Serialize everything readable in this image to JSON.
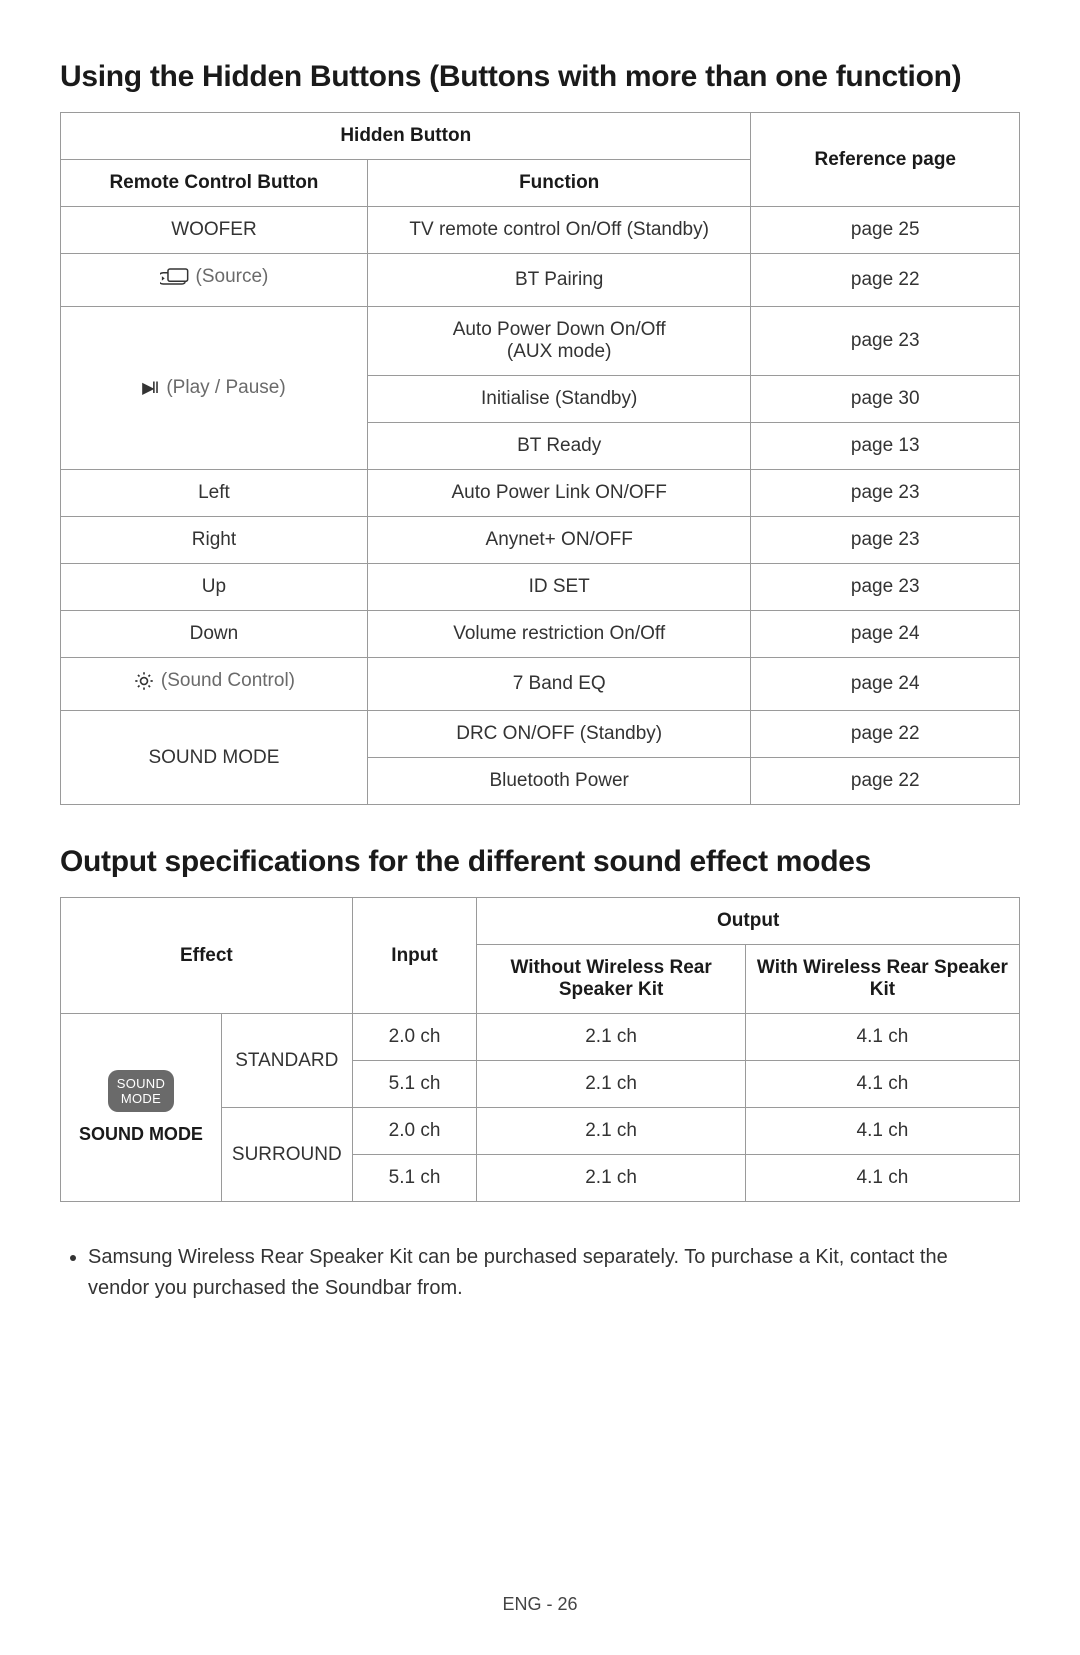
{
  "section1": {
    "title": "Using the Hidden Buttons (Buttons with more than one function)",
    "headers": {
      "hidden_button": "Hidden Button",
      "remote": "Remote Control Button",
      "function": "Function",
      "ref": "Reference page"
    },
    "rows": {
      "woofer": {
        "button": "WOOFER",
        "function": "TV remote control On/Off (Standby)",
        "ref": "page 25"
      },
      "source": {
        "button": "(Source)",
        "function": "BT Pairing",
        "ref": "page 22"
      },
      "playpause": {
        "button": "(Play / Pause)"
      },
      "pp_auto": {
        "function": "Auto Power Down On/Off\n(AUX mode)",
        "ref": "page 23"
      },
      "pp_init": {
        "function": "Initialise (Standby)",
        "ref": "page 30"
      },
      "pp_btready": {
        "function": "BT Ready",
        "ref": "page 13"
      },
      "left": {
        "button": "Left",
        "function": "Auto Power Link ON/OFF",
        "ref": "page 23"
      },
      "right": {
        "button": "Right",
        "function": "Anynet+ ON/OFF",
        "ref": "page 23"
      },
      "up": {
        "button": "Up",
        "function": "ID SET",
        "ref": "page 23"
      },
      "down": {
        "button": "Down",
        "function": "Volume restriction On/Off",
        "ref": "page 24"
      },
      "soundcontrol": {
        "button": "(Sound Control)",
        "function": "7 Band EQ",
        "ref": "page 24"
      },
      "soundmode": {
        "button": "SOUND MODE"
      },
      "sm_drc": {
        "function": "DRC ON/OFF (Standby)",
        "ref": "page 22"
      },
      "sm_btpower": {
        "function": "Bluetooth Power",
        "ref": "page 22"
      }
    }
  },
  "section2": {
    "title": "Output specifications for the different sound effect modes",
    "headers": {
      "effect": "Effect",
      "input": "Input",
      "output": "Output",
      "without": "Without Wireless Rear Speaker Kit",
      "with": "With Wireless Rear Speaker Kit"
    },
    "effect_button": "SOUND\nMODE",
    "effect_label": "SOUND MODE",
    "modes": {
      "standard": "STANDARD",
      "surround": "SURROUND"
    },
    "rows": [
      {
        "input": "2.0 ch",
        "without": "2.1 ch",
        "with": "4.1 ch"
      },
      {
        "input": "5.1 ch",
        "without": "2.1 ch",
        "with": "4.1 ch"
      },
      {
        "input": "2.0 ch",
        "without": "2.1 ch",
        "with": "4.1 ch"
      },
      {
        "input": "5.1 ch",
        "without": "2.1 ch",
        "with": "4.1 ch"
      }
    ]
  },
  "note": "Samsung Wireless Rear Speaker Kit can be purchased separately. To purchase a Kit, contact the vendor you purchased the Soundbar from.",
  "footer": "ENG - 26"
}
